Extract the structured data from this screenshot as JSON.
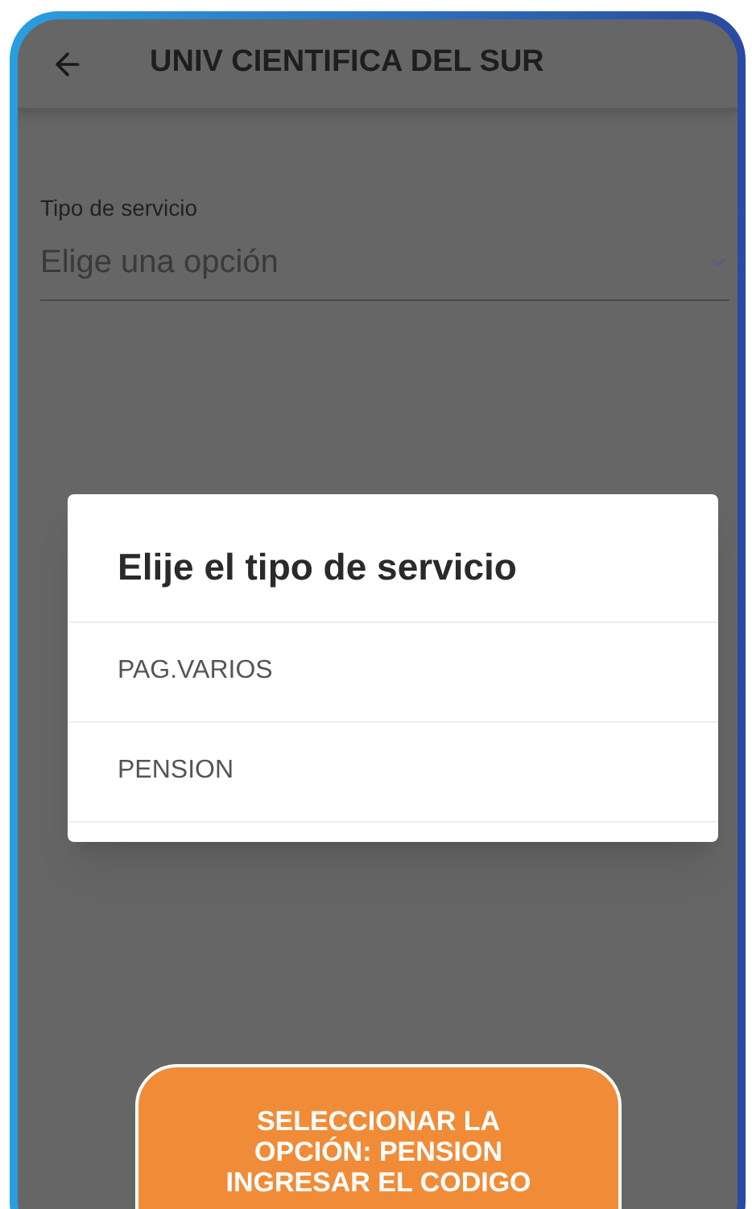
{
  "app_bar": {
    "title": "UNIV CIENTIFICA DEL SUR"
  },
  "field": {
    "label": "Tipo de servicio",
    "placeholder": "Elige una opción"
  },
  "dialog": {
    "title": "Elije el tipo de servicio",
    "options": [
      {
        "label": "PAG.VARIOS",
        "selected": false
      },
      {
        "label": "PENSION",
        "selected": false
      }
    ]
  },
  "callout": {
    "lines": [
      "SELECCIONAR LA",
      "OPCIÓN: PENSION",
      "INGRESAR EL CODIGO"
    ]
  }
}
